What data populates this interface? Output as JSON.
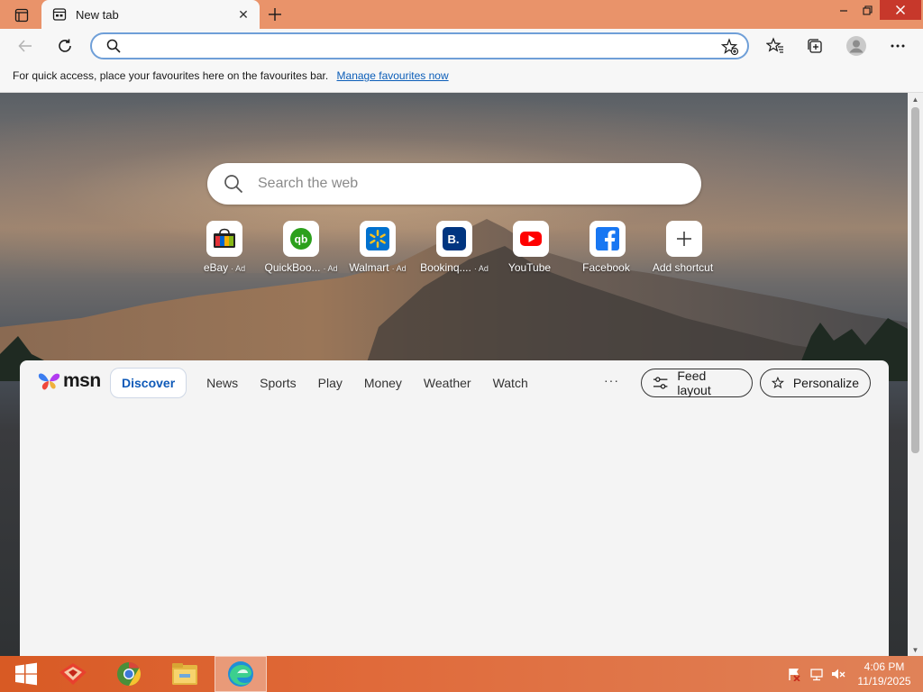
{
  "browser": {
    "tab": {
      "title": "New tab"
    },
    "address_bar": {
      "value": "",
      "placeholder": ""
    },
    "favourites_bar": {
      "message": "For quick access, place your favourites here on the favourites bar.",
      "link": "Manage favourites now"
    }
  },
  "newtab": {
    "search": {
      "placeholder": "Search the web"
    },
    "shortcuts": [
      {
        "label": "eBay",
        "ad": "· Ad",
        "icon": "ebay-icon"
      },
      {
        "label": "QuickBoo...",
        "ad": "· Ad",
        "icon": "quickbooks-icon"
      },
      {
        "label": "Walmart",
        "ad": "· Ad",
        "icon": "walmart-icon"
      },
      {
        "label": "Bookinq....",
        "ad": "· Ad",
        "icon": "booking-icon"
      },
      {
        "label": "YouTube",
        "ad": "",
        "icon": "youtube-icon"
      },
      {
        "label": "Facebook",
        "ad": "",
        "icon": "facebook-icon"
      },
      {
        "label": "Add shortcut",
        "ad": "",
        "icon": "plus-icon"
      }
    ]
  },
  "feed": {
    "logo_text": "msn",
    "nav": [
      "Discover",
      "News",
      "Sports",
      "Play",
      "Money",
      "Weather",
      "Watch"
    ],
    "more": "···",
    "feed_layout": "Feed layout",
    "personalize": "Personalize"
  },
  "taskbar": {
    "time": "4:06 PM",
    "date": "11/19/2025",
    "apps": [
      "start-icon",
      "app-icon",
      "chrome-icon",
      "file-explorer-icon",
      "edge-icon"
    ]
  },
  "colors": {
    "titlebar": "#e9936a",
    "close_button": "#c7382b",
    "address_border": "#6f9fd8",
    "link": "#0b5db8",
    "discover": "#0f5ab8",
    "taskbar": "#d85a24"
  }
}
